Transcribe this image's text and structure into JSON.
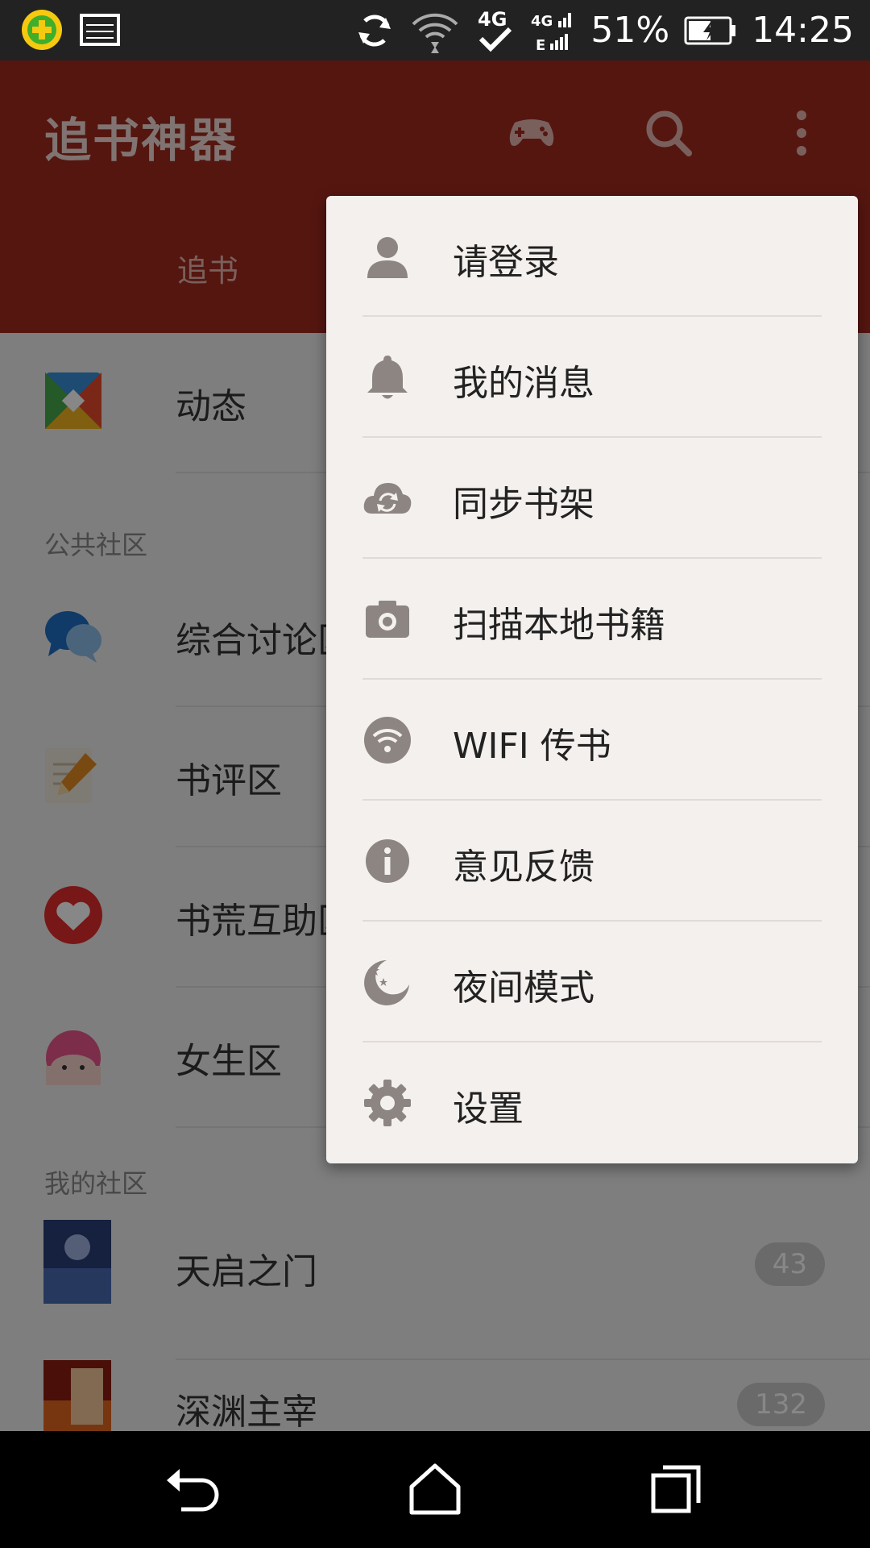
{
  "status_bar": {
    "battery": "51%",
    "time": "14:25",
    "icons": [
      "360-security-icon",
      "image-notification-icon",
      "sync-icon",
      "wifi-icon",
      "4g-icon",
      "signal-icon",
      "battery-icon"
    ]
  },
  "app_bar": {
    "title": "追书神器",
    "icons": [
      "gamepad-icon",
      "search-icon",
      "more-vertical-icon"
    ],
    "tab": "追书"
  },
  "list": {
    "feed_label": "动态",
    "public_section": "公共社区",
    "public_items": [
      {
        "label": "综合讨论区",
        "icon": "chat-bubbles-icon"
      },
      {
        "label": "书评区",
        "icon": "pencil-note-icon"
      },
      {
        "label": "书荒互助区",
        "icon": "heart-icon"
      },
      {
        "label": "女生区",
        "icon": "girl-face-icon"
      }
    ],
    "my_section": "我的社区",
    "my_items": [
      {
        "label": "天启之门",
        "count": "43"
      },
      {
        "label": "深渊主宰",
        "count": "132"
      }
    ]
  },
  "menu": {
    "items": [
      {
        "label": "请登录",
        "icon": "person-icon"
      },
      {
        "label": "我的消息",
        "icon": "bell-icon"
      },
      {
        "label": "同步书架",
        "icon": "cloud-sync-icon"
      },
      {
        "label": "扫描本地书籍",
        "icon": "camera-icon"
      },
      {
        "label": "WIFI 传书",
        "icon": "wifi-icon"
      },
      {
        "label": "意见反馈",
        "icon": "info-icon"
      },
      {
        "label": "夜间模式",
        "icon": "moon-icon"
      },
      {
        "label": "设置",
        "icon": "gear-icon"
      }
    ]
  },
  "nav_bar": {
    "icons": [
      "back-icon",
      "home-icon",
      "recents-icon"
    ]
  },
  "colors": {
    "brand": "#a12a1f",
    "menu_bg": "#f4f0ed",
    "menu_icon": "#8c8582"
  }
}
